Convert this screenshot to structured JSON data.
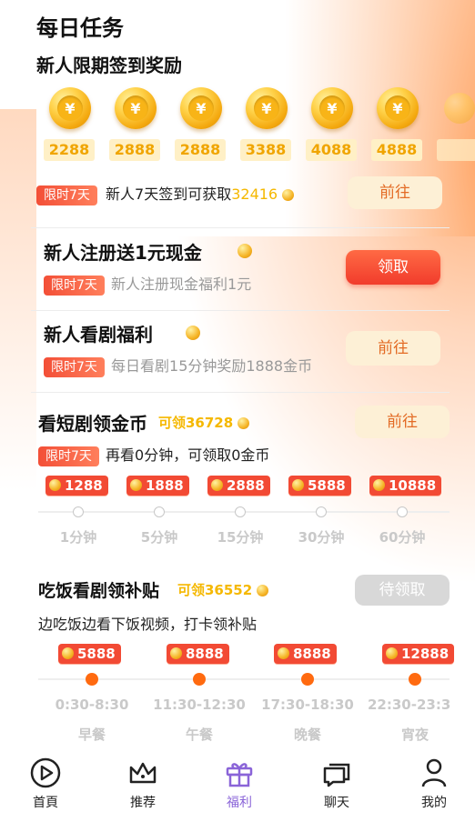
{
  "header": {
    "title": "每日任务"
  },
  "signin": {
    "title": "新人限期签到奖励",
    "coin_symbol": "¥",
    "days": [
      {
        "amount": "2288"
      },
      {
        "amount": "2888"
      },
      {
        "amount": "2888"
      },
      {
        "amount": "3388"
      },
      {
        "amount": "4088"
      },
      {
        "amount": "4888"
      }
    ],
    "tag": "限时7天",
    "desc": "新人7天签到可获取",
    "total": "32416",
    "button": "前往"
  },
  "register_task": {
    "title": "新人注册送1元现金",
    "tag": "限时7天",
    "desc": "新人注册现金福利1元",
    "button": "领取"
  },
  "watch_task": {
    "title": "新人看剧福利",
    "tag": "限时7天",
    "desc": "每日看剧15分钟奖励1888金币",
    "button": "前往"
  },
  "short_drama": {
    "title": "看短剧领金币",
    "claimable": "可领36728",
    "tag": "限时7天",
    "desc": "再看0分钟，可领取0金币",
    "button": "前往",
    "rewards": [
      {
        "amount": "1288",
        "label": "1分钟"
      },
      {
        "amount": "1888",
        "label": "5分钟"
      },
      {
        "amount": "2888",
        "label": "15分钟"
      },
      {
        "amount": "5888",
        "label": "30分钟"
      },
      {
        "amount": "10888",
        "label": "60分钟"
      }
    ]
  },
  "meal_subsidy": {
    "title": "吃饭看剧领补贴",
    "claimable": "可领36552",
    "desc": "边吃饭边看下饭视频，打卡领补贴",
    "button": "待领取",
    "rewards": [
      {
        "amount": "5888",
        "time": "0:30-8:30",
        "meal": "早餐"
      },
      {
        "amount": "8888",
        "time": "11:30-12:30",
        "meal": "午餐"
      },
      {
        "amount": "8888",
        "time": "17:30-18:30",
        "meal": "晚餐"
      },
      {
        "amount": "12888",
        "time": "22:30-23:3",
        "meal": "宵夜"
      }
    ]
  },
  "nav": {
    "items": [
      {
        "label": "首頁",
        "icon": "play-circle-icon"
      },
      {
        "label": "推荐",
        "icon": "crown-icon"
      },
      {
        "label": "福利",
        "icon": "gift-icon"
      },
      {
        "label": "聊天",
        "icon": "chat-icon"
      },
      {
        "label": "我的",
        "icon": "user-icon"
      }
    ],
    "active_color": "#8a64d8"
  },
  "colors": {
    "accent_red": "#f24a34",
    "coin_gold": "#f0a500",
    "claim_yellow": "#f5b800"
  }
}
